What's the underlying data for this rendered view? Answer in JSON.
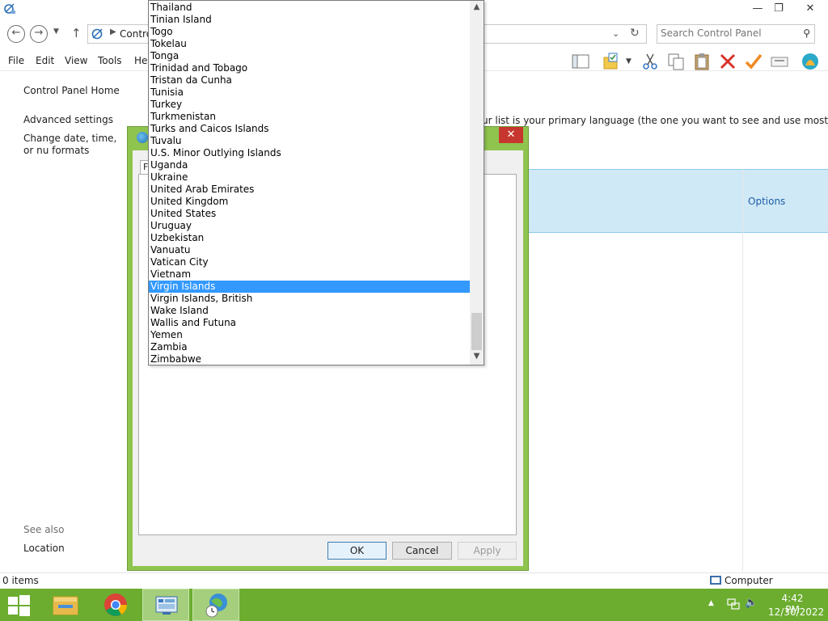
{
  "window": {
    "min_glyph": "—",
    "max_glyph": "❐",
    "close_glyph": "✕"
  },
  "address": {
    "breadcrumb": "Contro",
    "search_placeholder": "Search Control Panel"
  },
  "menu": {
    "file": "File",
    "edit": "Edit",
    "view": "View",
    "tools": "Tools",
    "help": "Hel"
  },
  "leftnav": {
    "home": "Control Panel Home",
    "advanced": "Advanced settings",
    "date_formats": "Change date, time, or nu formats",
    "see_also": "See also",
    "location": "Location"
  },
  "main": {
    "hint": "ur list is your primary language (the one you want to see and use most often).",
    "options": "Options"
  },
  "status": {
    "items": "0 items",
    "computer": "Computer"
  },
  "dialog": {
    "close_glyph": "✕",
    "tab_label": "F",
    "ok": "OK",
    "cancel": "Cancel",
    "apply": "Apply"
  },
  "dropdown": {
    "selected": "Virgin Islands",
    "items": [
      "Thailand",
      "Tinian Island",
      "Togo",
      "Tokelau",
      "Tonga",
      "Trinidad and Tobago",
      "Tristan da Cunha",
      "Tunisia",
      "Turkey",
      "Turkmenistan",
      "Turks and Caicos Islands",
      "Tuvalu",
      "U.S. Minor Outlying Islands",
      "Uganda",
      "Ukraine",
      "United Arab Emirates",
      "United Kingdom",
      "United States",
      "Uruguay",
      "Uzbekistan",
      "Vanuatu",
      "Vatican City",
      "Vietnam",
      "Virgin Islands",
      "Virgin Islands, British",
      "Wake Island",
      "Wallis and Futuna",
      "Yemen",
      "Zambia",
      "Zimbabwe"
    ]
  },
  "taskbar": {
    "time": "4:42 PM",
    "date": "12/30/2022"
  },
  "colors": {
    "taskbar": "#6cad2f",
    "dialog_frame": "#8fc44e",
    "selection": "#3399ff",
    "close_red": "#c7372f",
    "panel_highlight": "#d0e9f6"
  }
}
